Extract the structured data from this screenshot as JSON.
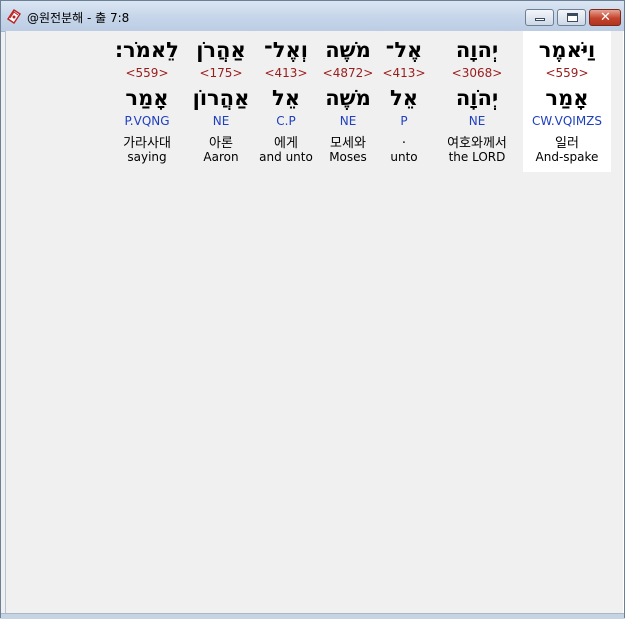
{
  "window": {
    "title": "@원전분해 - 출 7:8",
    "icon": "bible-book-icon",
    "controls": [
      "minimize",
      "maximize",
      "close"
    ],
    "close_glyph": "✕"
  },
  "colors": {
    "strong_number": "#9b1c1c",
    "morphology": "#1f3fbf",
    "selected_bg": "#ffffff"
  },
  "words": [
    {
      "heb": "וַיֹּאמֶר",
      "strong": "<559>",
      "lemma": "אָמַר",
      "morph": "CW.VQIMZS",
      "korean": "일러",
      "english": "And-spake",
      "selected": true
    },
    {
      "heb": "יְהוָה",
      "strong": "<3068>",
      "lemma": "יְהֹוָה",
      "morph": "NE",
      "korean": "여호와께서",
      "english": "the LORD",
      "selected": false
    },
    {
      "heb": "אֶל־",
      "strong": "<413>",
      "lemma": "אֵל",
      "morph": "P",
      "korean": ".",
      "english": "unto",
      "selected": false
    },
    {
      "heb": "מֹשֶׁה",
      "strong": "<4872>",
      "lemma": "מֹשֶׁה",
      "morph": "NE",
      "korean": "모세와",
      "english": "Moses",
      "selected": false
    },
    {
      "heb": "וְאֶל־",
      "strong": "<413>",
      "lemma": "אֵל",
      "morph": "C.P",
      "korean": "에게",
      "english": "and unto",
      "selected": false
    },
    {
      "heb": "אַהֲרֹן",
      "strong": "<175>",
      "lemma": "אַהֲרוֹן",
      "morph": "NE",
      "korean": "아론",
      "english": "Aaron",
      "selected": false
    },
    {
      "heb": "לֵאמֹר׃",
      "strong": "<559>",
      "lemma": "אָמַר",
      "morph": "P.VQNG",
      "korean": "가라사대",
      "english": "saying",
      "selected": false
    }
  ]
}
